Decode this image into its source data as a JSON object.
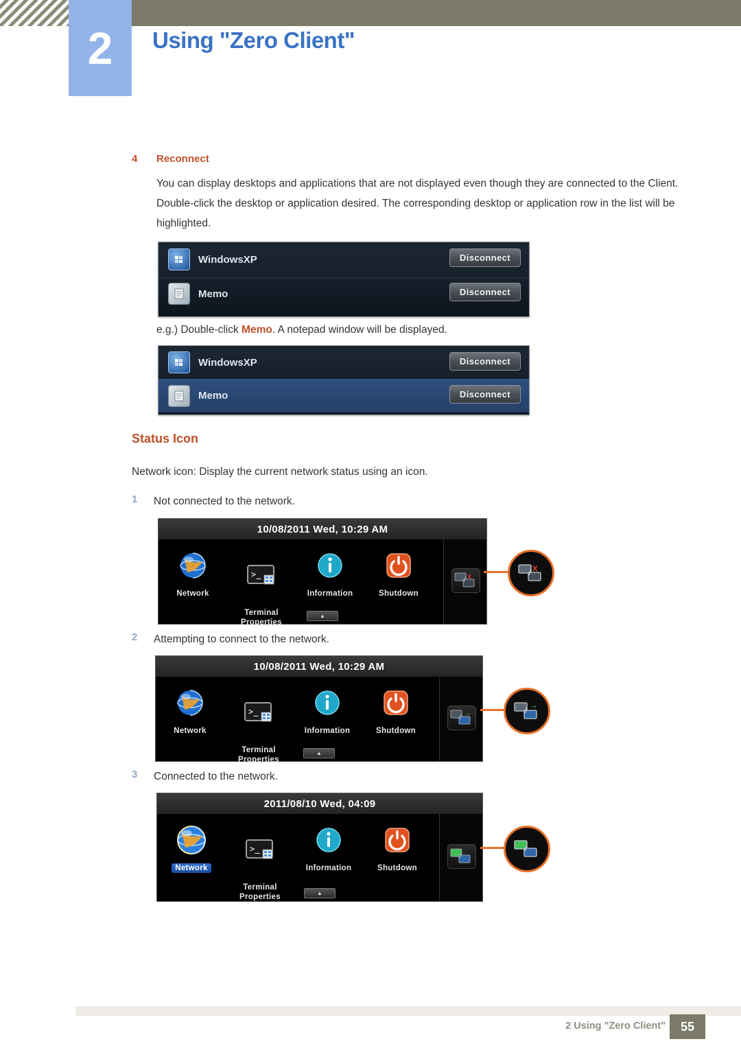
{
  "header": {
    "chapter_number": "2",
    "chapter_title": "Using \"Zero Client\""
  },
  "section_reconnect": {
    "number": "4",
    "title": "Reconnect",
    "paragraph": "You can display desktops and applications that are not displayed even though they are connected to the Client. Double-click the desktop or application desired. The corresponding desktop or application row in the list will be highlighted.",
    "caption_prefix": "e.g.) Double-click ",
    "caption_highlight": "Memo",
    "caption_suffix": ". A notepad window will be displayed."
  },
  "client_list_before": {
    "rows": [
      {
        "icon": "windows-icon",
        "label": "WindowsXP",
        "button": "Disconnect",
        "selected": false
      },
      {
        "icon": "memo-icon",
        "label": "Memo",
        "button": "Disconnect",
        "selected": false
      }
    ]
  },
  "client_list_after": {
    "rows": [
      {
        "icon": "windows-icon",
        "label": "WindowsXP",
        "button": "Disconnect",
        "selected": false
      },
      {
        "icon": "memo-icon",
        "label": "Memo",
        "button": "Disconnect",
        "selected": true
      }
    ]
  },
  "status_icon": {
    "title": "Status Icon",
    "intro": "Network icon: Display the current network status using an icon.",
    "states": [
      {
        "number": "1",
        "text": "Not connected to the network.",
        "osd_title": "10/08/2011 Wed, 10:29 AM",
        "items": [
          "Network",
          "Terminal\nProperties",
          "Information",
          "Shutdown"
        ],
        "badge": "network-disconnected-icon",
        "badge_mark": "x",
        "badge_mark_color": "#d03a2b"
      },
      {
        "number": "2",
        "text": "Attempting to connect to the network.",
        "osd_title": "10/08/2011 Wed, 10:29 AM",
        "items": [
          "Network",
          "Terminal\nProperties",
          "Information",
          "Shutdown"
        ],
        "badge": "network-connecting-icon",
        "badge_mark": "→",
        "badge_mark_color": "#3fbf55"
      },
      {
        "number": "3",
        "text": "Connected to the network.",
        "osd_title": "2011/08/10 Wed, 04:09",
        "items": [
          "Network",
          "Terminal\nProperties",
          "Information",
          "Shutdown"
        ],
        "badge": "network-connected-icon",
        "badge_mark": "",
        "badge_mark_color": "#3fbf55",
        "network_selected": true
      }
    ]
  },
  "footer": {
    "text": "2 Using \"Zero Client\"",
    "page": "55"
  },
  "colors": {
    "accent_red": "#c0502a",
    "accent_blue": "#3a73c4",
    "chapter_box": "#92b4e8",
    "header_bar": "#7b7a68",
    "callout_orange": "#e8722b"
  }
}
